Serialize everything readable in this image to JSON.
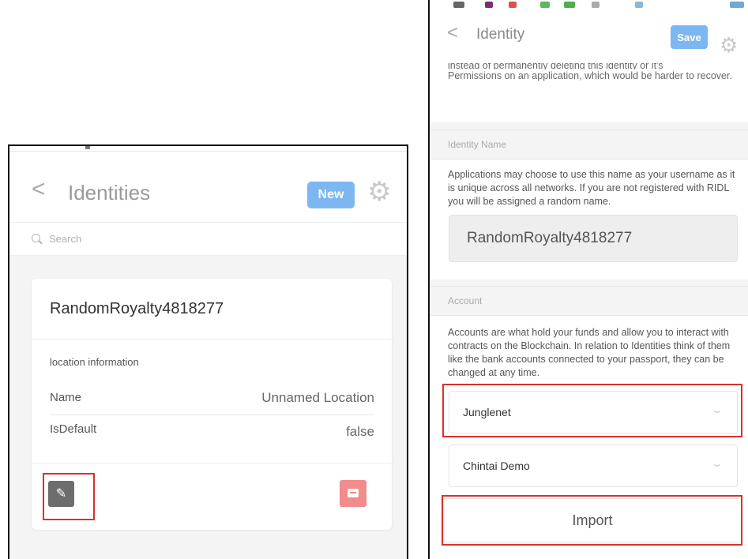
{
  "identities_panel": {
    "header": {
      "back_glyph": "<",
      "title": "Identities",
      "new_label": "New",
      "settings_icon": "gear-icon"
    },
    "search": {
      "placeholder": "Search"
    },
    "card": {
      "name": "RandomRoyalty4818277",
      "location_label": "location information",
      "rows": [
        {
          "key": "Name",
          "value": "Unnamed Location"
        },
        {
          "key": "IsDefault",
          "value": "false"
        }
      ],
      "edit_icon": "pencil-icon",
      "delete_icon": "minus-icon"
    }
  },
  "identity_panel": {
    "header": {
      "back_glyph": "<",
      "title": "Identity",
      "save_label": "Save",
      "settings_icon": "gear-icon"
    },
    "clipped_intro": {
      "cut_line": "instead of permanently deleting this identity or it's",
      "lines": "Permissions on an application, which would be harder to recover."
    },
    "identity_name_section": {
      "heading": "Identity Name",
      "description": "Applications may choose to use this name as your username as it is unique across all networks. If you are not registered with RIDL you will be assigned a random name.",
      "value": "RandomRoyalty4818277"
    },
    "account_section": {
      "heading": "Account",
      "description": "Accounts are what hold your funds and allow you to interact with contracts on the Blockchain. In relation to Identities think of them like the bank accounts connected to your passport, they can be changed at any time.",
      "accounts": [
        "Junglenet",
        "Chintai Demo"
      ],
      "import_label": "Import"
    }
  },
  "colors": {
    "accent_blue": "#7db7f2",
    "highlight_red": "#d8322c",
    "delete_red": "#f28b8b"
  }
}
